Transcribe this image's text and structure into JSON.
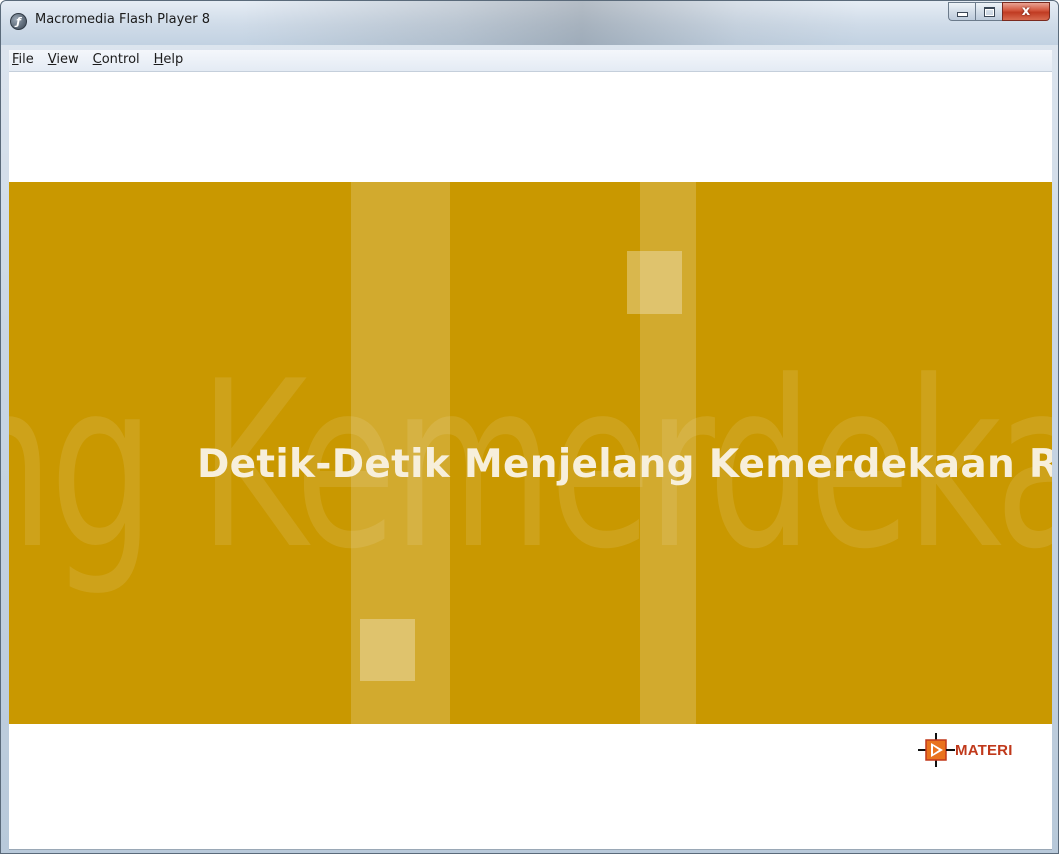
{
  "window": {
    "title": "Macromedia Flash Player 8",
    "icon": "flash-player-icon",
    "controls": {
      "minimize_icon": "minimize-icon",
      "maximize_icon": "maximize-icon",
      "close_glyph": "x"
    }
  },
  "menubar": {
    "items": [
      {
        "label": "File",
        "accel": "F",
        "rest": "ile"
      },
      {
        "label": "View",
        "accel": "V",
        "rest": "iew"
      },
      {
        "label": "Control",
        "accel": "C",
        "rest": "ontrol"
      },
      {
        "label": "Help",
        "accel": "H",
        "rest": "elp"
      }
    ]
  },
  "stage": {
    "background_text": "ng Kemerdekaan R",
    "headline": "Detik-Detik Menjelang Kemerdekaan R",
    "colors": {
      "banner": "#c99800",
      "headline": "#f7efdb",
      "accent": "#c0391b"
    },
    "materi_button": {
      "label": "MATERI",
      "icon": "target-arrow-icon"
    }
  }
}
